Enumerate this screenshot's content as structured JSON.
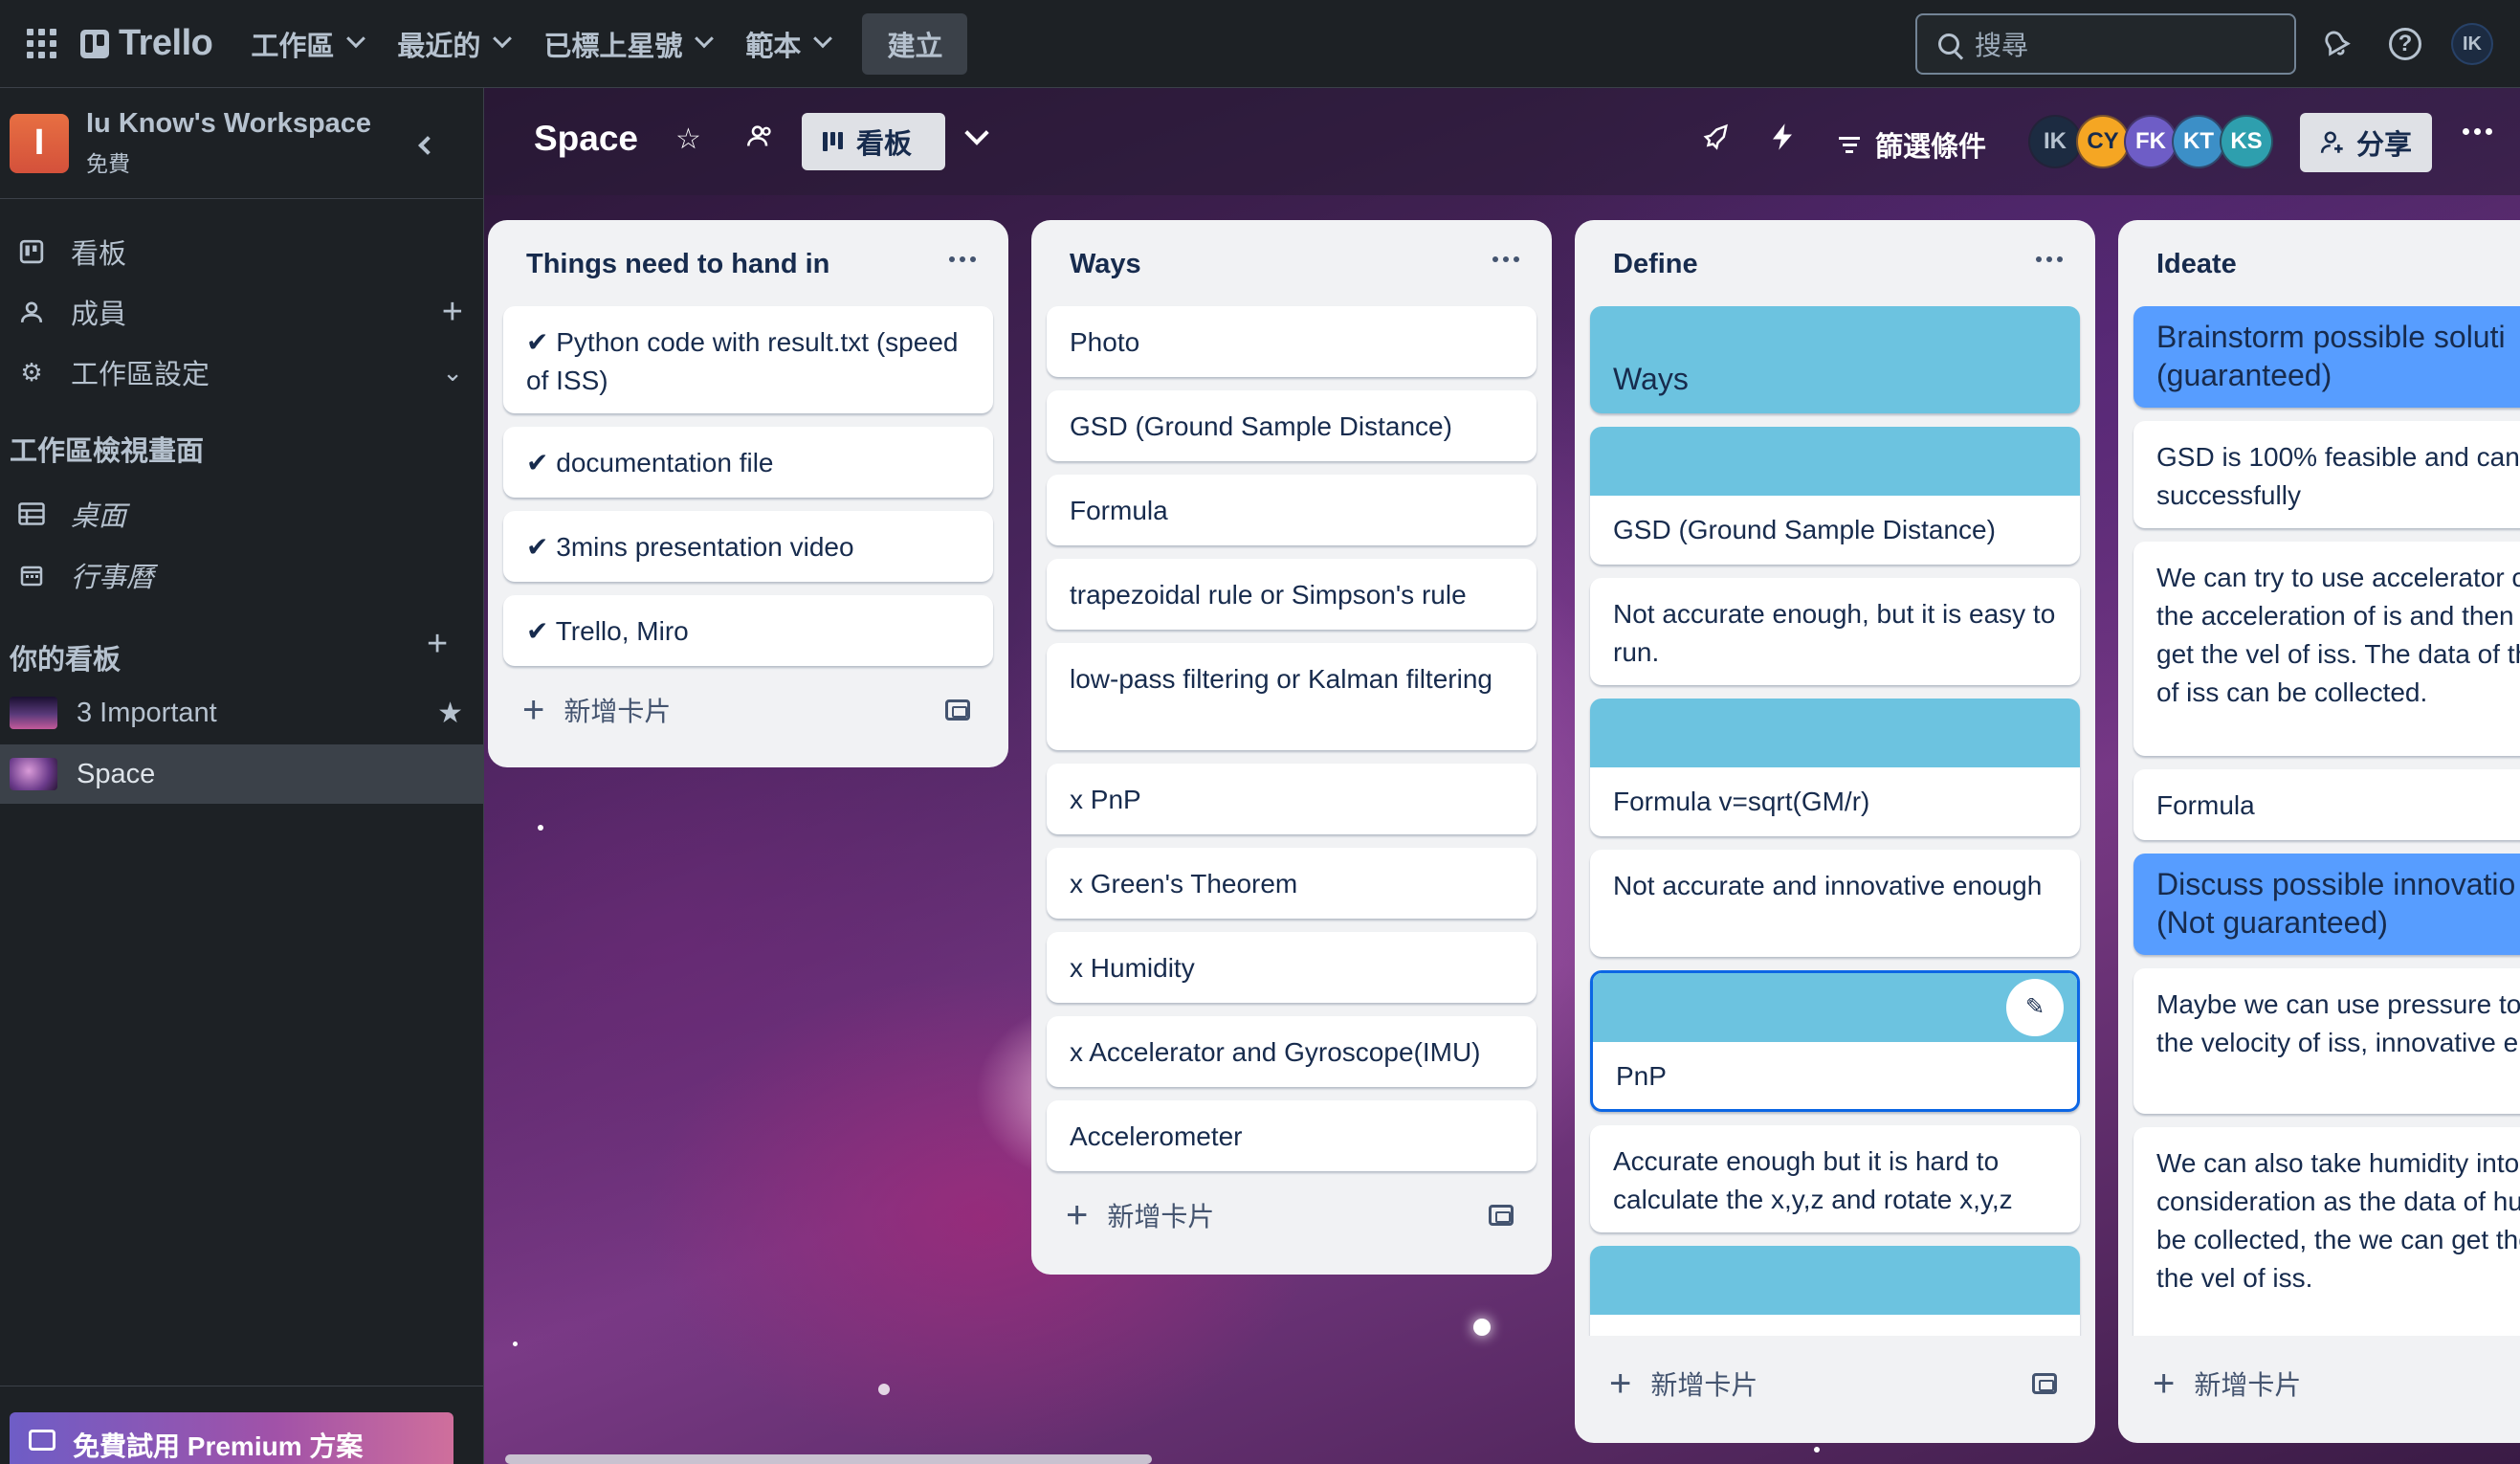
{
  "topbar": {
    "logo": "Trello",
    "menus": [
      "工作區",
      "最近的",
      "已標上星號",
      "範本"
    ],
    "create_label": "建立",
    "search_placeholder": "搜尋",
    "user_initials": "IK"
  },
  "sidebar": {
    "workspace_initial": "I",
    "workspace_name": "Iu Know's Workspace",
    "workspace_plan": "免費",
    "items": [
      {
        "label": "看板",
        "icon": "board-icon"
      },
      {
        "label": "成員",
        "icon": "person-icon"
      },
      {
        "label": "工作區設定",
        "icon": "gear-icon"
      }
    ],
    "views_heading": "工作區檢視畫面",
    "views": [
      {
        "label": "桌面",
        "icon": "table-icon"
      },
      {
        "label": "行事曆",
        "icon": "calendar-icon"
      }
    ],
    "boards_heading": "你的看板",
    "boards": [
      {
        "label": "3 Important",
        "starred": true
      },
      {
        "label": "Space",
        "active": true
      }
    ],
    "premium_label": "免費試用 Premium 方案"
  },
  "board": {
    "title": "Space",
    "view_label": "看板",
    "filter_label": "篩選條件",
    "share_label": "分享",
    "members": [
      {
        "initials": "IK",
        "color": "#1c2b41",
        "text": "#b6c2cf"
      },
      {
        "initials": "CY",
        "color": "#f5a623",
        "text": "#172b4d"
      },
      {
        "initials": "FK",
        "color": "#6e5dc6",
        "text": "#ffffff"
      },
      {
        "initials": "KT",
        "color": "#3c8fc7",
        "text": "#ffffff"
      },
      {
        "initials": "KS",
        "color": "#2e9fae",
        "text": "#ffffff"
      }
    ]
  },
  "lists": [
    {
      "title": "Things need to hand in",
      "cards": [
        "✔ Python code with result.txt (speed of ISS)",
        "✔ documentation file",
        "✔ 3mins presentation video",
        "✔ Trello, Miro"
      ],
      "add_label": "新增卡片"
    },
    {
      "title": "Ways",
      "cards": [
        "Photo",
        "GSD (Ground Sample Distance)",
        "Formula",
        "trapezoidal rule or Simpson's rule",
        "low-pass filtering or Kalman filtering",
        "x PnP",
        "x Green's Theorem",
        "x Humidity",
        "x Accelerator and Gyroscope(IMU)",
        "Accelerometer"
      ],
      "add_label": "新增卡片"
    },
    {
      "title": "Define",
      "cards": [
        "Ways",
        "GSD (Ground Sample Distance)",
        "Not accurate enough, but it is easy to run.",
        "Formula v=sqrt(GM/r)",
        "Not accurate and innovative enough",
        "PnP",
        "Accurate enough but it is hard to calculate the x,y,z and rotate x,y,z",
        ""
      ],
      "add_label": "新增卡片"
    },
    {
      "title": "Ideate",
      "cards": [
        "Brainstorm possible soluti (guaranteed)",
        "GSD is 100% feasible and can successfully",
        "We can try to use accelerator calculate the acceleration of is and then we might get the vel of iss. The data of the acceler of iss can be collected.",
        "Formula",
        "Discuss possible innovatio ideas (Not guaranteed)",
        "Maybe we can use pressure to calculate the velocity of iss, innovative enough",
        "We can also take humidity into consideration as the data of humidity can be collected, the we can get the data of the vel of iss."
      ],
      "add_label": "新增卡片"
    }
  ]
}
